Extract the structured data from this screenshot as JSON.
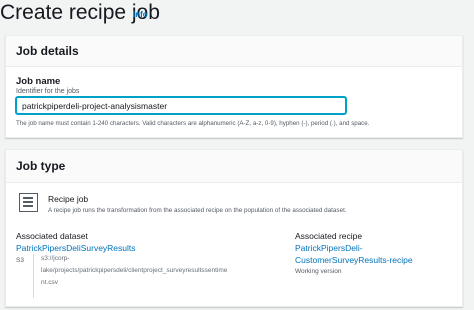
{
  "header": {
    "title": "Create recipe job",
    "info": "Info"
  },
  "job_details": {
    "title": "Job details",
    "job_name_label": "Job name",
    "job_name_description": "Identifier for the jobs",
    "job_name_value": "patrickpiperdeli-project-analysismaster",
    "constraint": "The job name must contain 1-240 characters. Valid characters are alphanumeric (A-Z, a-z, 0-9), hyphen (-), period (.), and space."
  },
  "job_type": {
    "title": "Job type",
    "option_title": "Recipe job",
    "option_description": "A recipe job runs the transformation from the associated recipe on the population of the associated dataset.",
    "dataset": {
      "label": "Associated dataset",
      "name": "PatrickPipersDeliSurveyResults",
      "source_tag": "S3",
      "path_lines": [
        "s3://jcorp-",
        "lake/projects/patrickpipersdeli/clientproject_surveyresultssentime",
        "nt.csv"
      ]
    },
    "recipe": {
      "label": "Associated recipe",
      "name_lines": [
        "PatrickPipersDeli-",
        "CustomerSurveyResults-recipe"
      ],
      "version": "Working version"
    }
  }
}
